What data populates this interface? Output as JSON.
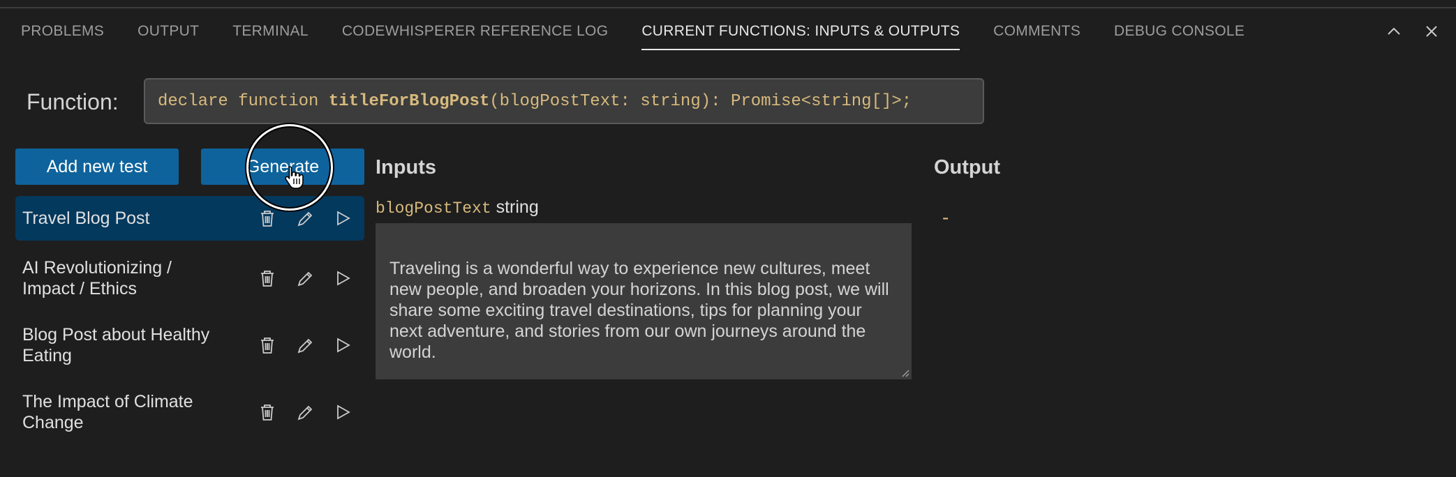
{
  "panel": {
    "tabs": [
      {
        "label": "PROBLEMS"
      },
      {
        "label": "OUTPUT"
      },
      {
        "label": "TERMINAL"
      },
      {
        "label": "CODEWHISPERER REFERENCE LOG"
      },
      {
        "label": "CURRENT FUNCTIONS: INPUTS & OUTPUTS"
      },
      {
        "label": "COMMENTS"
      },
      {
        "label": "DEBUG CONSOLE"
      }
    ],
    "active_tab": "CURRENT FUNCTIONS: INPUTS & OUTPUTS",
    "actions": [
      "chevron-up-icon",
      "close-icon"
    ]
  },
  "function": {
    "label": "Function:",
    "prefix": "declare function ",
    "name": "titleForBlogPost",
    "suffix": "(blogPostText: string): Promise<string[]>;"
  },
  "buttons": {
    "add_test": "Add new test",
    "generate": "Generate"
  },
  "tests": [
    {
      "name": "Travel Blog Post",
      "selected": true
    },
    {
      "name": "AI Revolutionizing / Impact / Ethics",
      "selected": false
    },
    {
      "name": "Blog Post about Healthy Eating",
      "selected": false
    },
    {
      "name": "The Impact of Climate Change",
      "selected": false
    }
  ],
  "inputs": {
    "title": "Inputs",
    "param_name": "blogPostText",
    "param_type": "string",
    "value": "Traveling is a wonderful way to experience new cultures, meet new people, and broaden your horizons. In this blog post, we will share some exciting travel destinations, tips for planning your next adventure, and stories from our own journeys around the world."
  },
  "output": {
    "title": "Output",
    "value": "-"
  },
  "colors": {
    "background": "#1e1e1e",
    "button": "#0e639c",
    "selected_row": "#04395e",
    "code_text": "#d7ba7d"
  }
}
